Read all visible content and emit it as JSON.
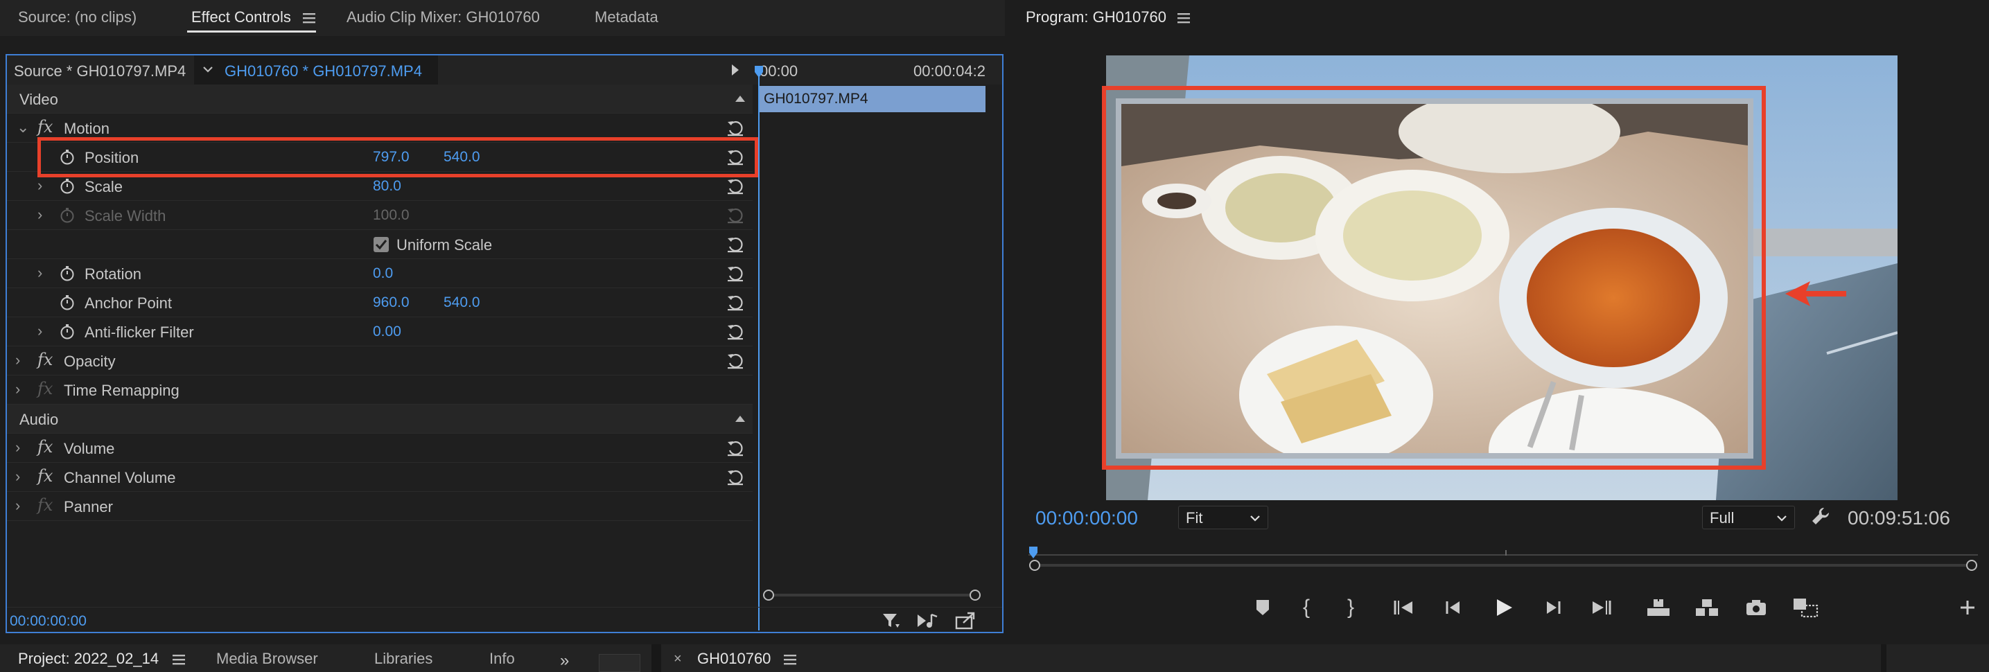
{
  "source_panel": {
    "tabs": [
      "Source: (no clips)",
      "Effect Controls",
      "Audio Clip Mixer: GH010760",
      "Metadata"
    ],
    "active_tab": "Effect Controls",
    "source_clip": "Source * GH010797.MP4",
    "sequence_clip": "GH010760 * GH010797.MP4",
    "timeline": {
      "time_start": "00:00",
      "time_end": "00:00:04:2",
      "clip_name": "GH010797.MP4"
    },
    "sections": {
      "video": "Video",
      "audio": "Audio"
    },
    "effects": {
      "motion": "Motion",
      "position": {
        "label": "Position",
        "x": "797.0",
        "y": "540.0"
      },
      "scale": {
        "label": "Scale",
        "value": "80.0"
      },
      "scale_width": {
        "label": "Scale Width",
        "value": "100.0"
      },
      "uniform_scale": {
        "label": "Uniform Scale",
        "checked": true
      },
      "rotation": {
        "label": "Rotation",
        "value": "0.0"
      },
      "anchor_point": {
        "label": "Anchor Point",
        "x": "960.0",
        "y": "540.0"
      },
      "anti_flicker": {
        "label": "Anti-flicker Filter",
        "value": "0.00"
      },
      "opacity": "Opacity",
      "time_remapping": "Time Remapping",
      "volume": "Volume",
      "channel_volume": "Channel Volume",
      "panner": "Panner"
    },
    "timecode": "00:00:00:00"
  },
  "program_monitor": {
    "title": "Program: GH010760",
    "timecode_current": "00:00:00:00",
    "zoom_label": "Fit",
    "quality_label": "Full",
    "timecode_duration": "00:09:51:06"
  },
  "bottom_bar": {
    "tabs": [
      "Project: 2022_02_14",
      "Media Browser",
      "Libraries",
      "Info"
    ],
    "timeline_tab": "GH010760"
  },
  "colors": {
    "accent_blue": "#4e9cf0",
    "highlight_red": "#e8402a",
    "panel_bg": "#1f1f1f",
    "clip_blue": "#7b9fd0"
  }
}
